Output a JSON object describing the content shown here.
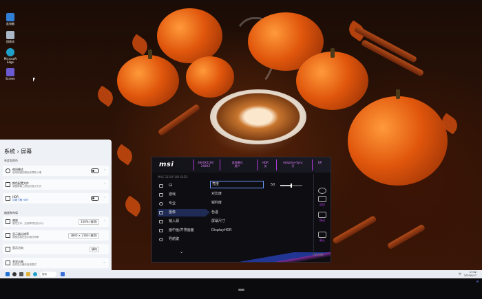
{
  "desktop": {
    "icons": [
      {
        "label": "此电脑",
        "icon": "computer-icon",
        "color": "#2f7fd6"
      },
      {
        "label": "回收站",
        "icon": "recycle-bin-icon",
        "color": "#a9b7c6"
      },
      {
        "label": "Microsoft Edge",
        "icon": "edge-icon",
        "color": "#1fa0c9"
      },
      {
        "label": "Screen",
        "icon": "screen-app-icon",
        "color": "#6a5bd1"
      }
    ]
  },
  "settings": {
    "title": "系统 › 屏幕",
    "subtitle": "亮度和颜色",
    "rows": [
      {
        "label": "夜间模式",
        "desc": "使用较暖的颜色来帮助入睡",
        "icon": "night-light-icon",
        "control": "toggle"
      },
      {
        "label": "颜色配置文件",
        "desc": "调整屏幕上颜色的显示方式",
        "icon": "color-profile-icon",
        "control": "chevron"
      },
      {
        "label": "HDR",
        "desc": "详细了解 HDR",
        "icon": "hdr-icon",
        "control": "toggle"
      }
    ],
    "section2": "缩放和布局",
    "rows2": [
      {
        "label": "缩放",
        "desc": "更改文本、应用等项目的大小",
        "icon": "scale-icon",
        "value": "150% (推荐)"
      },
      {
        "label": "显示器分辨率",
        "desc": "调整连接的显示器分辨率",
        "icon": "resolution-icon",
        "value": "3840 × 2160 (推荐)"
      },
      {
        "label": "显示方向",
        "desc": "",
        "icon": "orientation-icon",
        "value": "横向"
      },
      {
        "label": "多显示器",
        "desc": "选择显示器的呈现模式",
        "icon": "multi-display-icon",
        "value": ""
      }
    ]
  },
  "taskbar": {
    "search": "搜索",
    "clock_time": "17:02",
    "clock_date": "2023/9/17",
    "tray": "中",
    "icons": [
      "start-icon",
      "search-icon",
      "task-view-icon",
      "file-explorer-icon",
      "edge-icon",
      "store-icon"
    ]
  },
  "osd": {
    "brand": "msi",
    "model": "MAG 321UP QD-OLED",
    "header": [
      {
        "line1": "3840X2160",
        "line2": "240HZ"
      },
      {
        "line1": "游戏模式",
        "line2": "用户"
      },
      {
        "line1": "HDR",
        "line2": "关"
      },
      {
        "line1": "Adaptive-Sync",
        "line2": "开"
      },
      {
        "line1": "DP",
        "line2": ""
      }
    ],
    "menu": [
      {
        "label": "GI",
        "icon": "gi-icon"
      },
      {
        "label": "游戏",
        "icon": "gamepad-icon"
      },
      {
        "label": "专业",
        "icon": "pro-icon"
      },
      {
        "label": "图像",
        "icon": "image-icon"
      },
      {
        "label": "输入源",
        "icon": "input-source-icon"
      },
      {
        "label": "画中画/并排画面",
        "icon": "pip-icon"
      },
      {
        "label": "导航键",
        "icon": "nav-key-icon"
      }
    ],
    "active_menu": 3,
    "submenu": [
      "亮度",
      "对比度",
      "锐利度",
      "色温",
      "屏幕尺寸",
      "DisplayHDR"
    ],
    "active_sub": 0,
    "brightness_value": "50",
    "brightness_fraction": 0.5,
    "controls": [
      {
        "label": "",
        "icon": "gear-icon"
      },
      {
        "label": "返回",
        "icon": "back-icon"
      },
      {
        "label": "移动",
        "icon": "move-icon"
      },
      {
        "label": "确认",
        "icon": "confirm-icon"
      }
    ],
    "footer": "FW.008",
    "colors": {
      "accent": "#b23ad9",
      "selection": "#1f2a55",
      "highlight": "#6d9bff"
    }
  }
}
